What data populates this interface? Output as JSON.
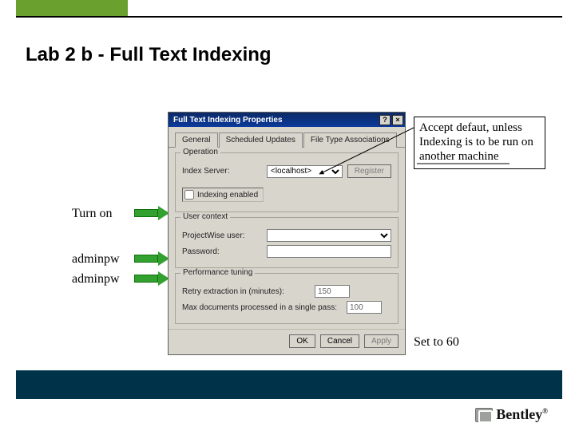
{
  "slide": {
    "title": "Lab 2 b - Full Text Indexing"
  },
  "callouts": {
    "accept_default": "Accept defaut, unless Indexing is to be run on another machine",
    "turn_on": "Turn on",
    "adminpw1": "adminpw",
    "adminpw2": "adminpw",
    "set60": "Set to 60"
  },
  "dialog": {
    "title": "Full Text Indexing Properties",
    "help_btn": "?",
    "close_btn": "×",
    "tabs": {
      "general": "General",
      "scheduled": "Scheduled Updates",
      "filetype": "File Type Associations"
    },
    "operation": {
      "legend": "Operation",
      "index_server_label": "Index Server:",
      "index_server_value": "<localhost>",
      "register_btn": "Register",
      "indexing_enabled_label": "Indexing enabled"
    },
    "user_context": {
      "legend": "User context",
      "user_label": "ProjectWise user:",
      "password_label": "Password:"
    },
    "perf": {
      "legend": "Performance tuning",
      "retry_label": "Retry extraction in (minutes):",
      "retry_value": "150",
      "maxdocs_label": "Max documents processed in a single pass:",
      "maxdocs_value": "100"
    },
    "buttons": {
      "ok": "OK",
      "cancel": "Cancel",
      "apply": "Apply"
    }
  },
  "branding": {
    "bentley": "Bentley"
  }
}
